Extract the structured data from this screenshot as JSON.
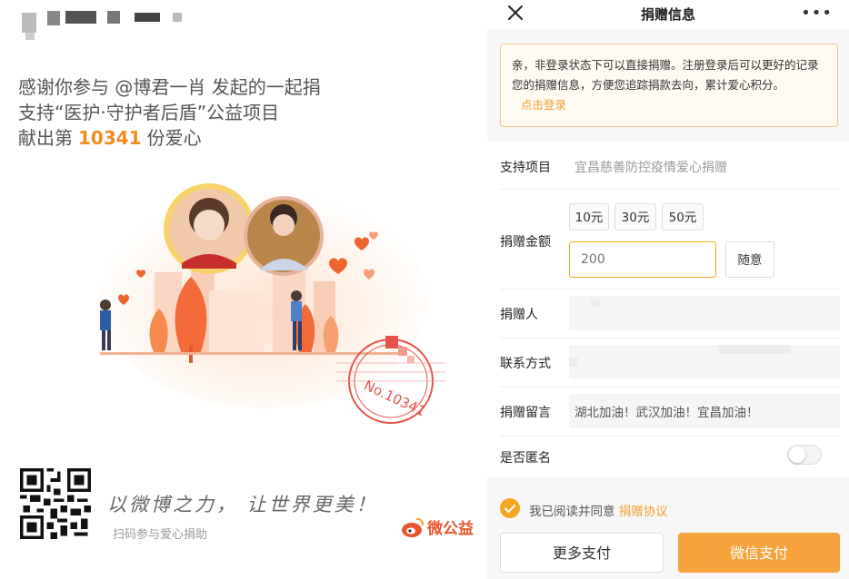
{
  "poster": {
    "intro_line1": "感谢你参与 @博君一肖 发起的一起捐",
    "intro_line2": "支持“医护·守护者后盾”公益项目",
    "intro_line3_prefix": "献出第",
    "donation_number": "10341",
    "intro_line3_suffix": "份爱心",
    "stamp_text": "No.10341",
    "slogan": "以微博之力， 让世界更美！",
    "scan_text": "扫码参与爱心捐助",
    "logo_text": "微公益",
    "accent_color": "#f08c1e"
  },
  "panel": {
    "title": "捐赠信息",
    "notice_text": "亲，非登录状态下可以直接捐赠。注册登录后可以更好的记录您的捐赠信息，方便您追踪捐款去向，累计爱心积分。",
    "notice_link": "点击登录",
    "project_label": "支持项目",
    "project_value": "宜昌慈善防控疫情爱心捐赠",
    "amount_label": "捐赠金额",
    "amount_options": [
      "10元",
      "30元",
      "50元"
    ],
    "amount_placeholder": "200",
    "amount_custom": "随意",
    "donor_label": "捐赠人",
    "contact_label": "联系方式",
    "message_label": "捐赠留言",
    "message_value": "湖北加油！武汉加油！宜昌加油！",
    "anonymous_label": "是否匿名",
    "agree_text": "我已阅读并同意",
    "agree_link": "捐赠协议",
    "btn_more": "更多支付",
    "btn_wechat": "微信支付",
    "accent_color": "#f6a33c"
  }
}
